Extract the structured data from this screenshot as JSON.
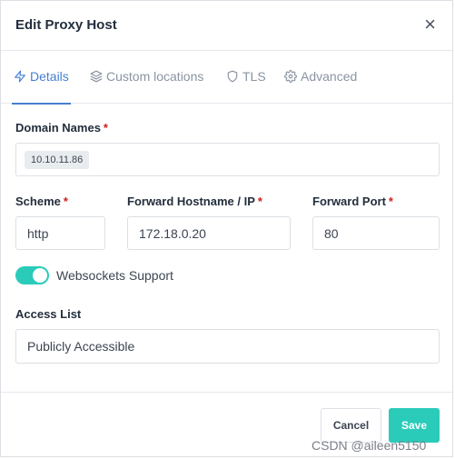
{
  "dialog": {
    "title": "Edit Proxy Host",
    "close_glyph": "×"
  },
  "tabs": [
    {
      "label": "Details",
      "icon": "lightning-icon",
      "active": true
    },
    {
      "label": "Custom locations",
      "icon": "layers-icon",
      "active": false
    },
    {
      "label": "TLS",
      "icon": "shield-icon",
      "active": false
    },
    {
      "label": "Advanced",
      "icon": "gear-icon",
      "active": false
    }
  ],
  "form": {
    "domain_names": {
      "label": "Domain Names",
      "required": "*",
      "tags": [
        "10.10.11.86"
      ]
    },
    "scheme": {
      "label": "Scheme",
      "required": "*",
      "value": "http"
    },
    "forward_hostname": {
      "label": "Forward Hostname / IP",
      "required": "*",
      "value": "172.18.0.20"
    },
    "forward_port": {
      "label": "Forward Port",
      "required": "*",
      "value": "80"
    },
    "websockets": {
      "label": "Websockets Support",
      "enabled": true
    },
    "access_list": {
      "label": "Access List",
      "value": "Publicly Accessible"
    }
  },
  "footer": {
    "cancel_label": "Cancel",
    "save_label": "Save"
  },
  "watermark": "CSDN @aileen5150",
  "colors": {
    "accent_blue": "#467fcf",
    "teal": "#2bcbba",
    "required_red": "#cd201f"
  }
}
